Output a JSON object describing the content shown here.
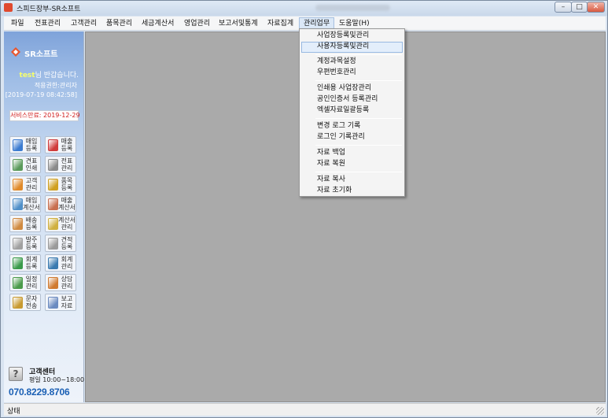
{
  "window": {
    "title": "스피드장부-SR소프트",
    "buttons": {
      "min": "–",
      "max": "□",
      "close": "✕"
    }
  },
  "menubar": {
    "items": [
      "파일",
      "전표관리",
      "고객관리",
      "품목관리",
      "세금계산서",
      "영업관리",
      "보고서및통계",
      "자료집계",
      "관리업무",
      "도움말(H)"
    ],
    "active": "관리업무"
  },
  "dropdown": {
    "items": [
      "사업장등록및관리",
      "사용자등록및관리",
      "계정과목설정",
      "우편번호관리",
      "인쇄용 사업장관리",
      "공인인증서 등록관리",
      "엑셀자료일괄등록",
      "변경 로그 기록",
      "로그인 기록관리",
      "자료 백업",
      "자료 복원",
      "자료 복사",
      "자료 초기화"
    ],
    "highlighted": "사용자등록및관리"
  },
  "sidebar": {
    "logo": "SR소프트",
    "user_id": "test",
    "greeting_suffix": "님 반갑습니다.",
    "permission": "적용권한:관리자",
    "login_time": "[2019-07-19 08:42:58]",
    "service_expiry": "서비스만료: 2019-12-29",
    "quick_buttons": [
      {
        "label1": "매입",
        "label2": "등록",
        "icon": "purchase-icon",
        "color": "#3b7bd0"
      },
      {
        "label1": "매출",
        "label2": "등록",
        "icon": "sales-icon",
        "color": "#d03b3b"
      },
      {
        "label1": "견표",
        "label2": "인쇄",
        "icon": "print-icon",
        "color": "#5a9a5a"
      },
      {
        "label1": "전표",
        "label2": "관리",
        "icon": "voucher-icon",
        "color": "#8a8a8a"
      },
      {
        "label1": "고객",
        "label2": "관리",
        "icon": "customer-icon",
        "color": "#e08a2a"
      },
      {
        "label1": "품목",
        "label2": "등록",
        "icon": "item-icon",
        "color": "#d0a020"
      },
      {
        "label1": "매입",
        "label2": "계산서",
        "icon": "purchase-invoice-icon",
        "color": "#4f8fc8"
      },
      {
        "label1": "매출",
        "label2": "계산서",
        "icon": "sales-invoice-icon",
        "color": "#c86f4f"
      },
      {
        "label1": "배송",
        "label2": "등록",
        "icon": "delivery-icon",
        "color": "#d08a40"
      },
      {
        "label1": "계산서",
        "label2": "관리",
        "icon": "invoice-manage-icon",
        "color": "#d0b040"
      },
      {
        "label1": "발주",
        "label2": "등록",
        "icon": "order-icon",
        "color": "#a0a0a0"
      },
      {
        "label1": "견적",
        "label2": "등록",
        "icon": "quote-icon",
        "color": "#9a9a9a"
      },
      {
        "label1": "회계",
        "label2": "등록",
        "icon": "accounting-icon",
        "color": "#3a9a4a"
      },
      {
        "label1": "회계",
        "label2": "관리",
        "icon": "accounting-manage-icon",
        "color": "#3a7ab0"
      },
      {
        "label1": "일정",
        "label2": "관리",
        "icon": "schedule-icon",
        "color": "#4a9a4a"
      },
      {
        "label1": "상담",
        "label2": "관리",
        "icon": "consult-icon",
        "color": "#d07a30"
      },
      {
        "label1": "문자",
        "label2": "전송",
        "icon": "sms-icon",
        "color": "#c89a30"
      },
      {
        "label1": "보고",
        "label2": "자료",
        "icon": "report-icon",
        "color": "#6a8ac0"
      }
    ],
    "support": {
      "title": "고객센터",
      "hours": "평일 10:00~18:00",
      "phone": "070.8229.8706"
    }
  },
  "statusbar": {
    "text": "상태"
  }
}
